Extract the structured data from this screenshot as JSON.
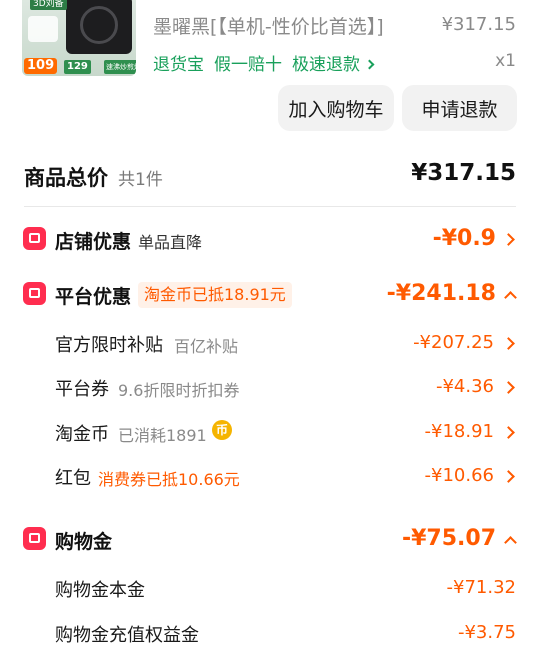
{
  "product": {
    "thumb": {
      "tag": "3D刘备",
      "price_main": "109",
      "price_secondary": "129",
      "strip": "速沸炒煎焖炖"
    },
    "sku": "墨曜黑[【单机-性价比首选】]",
    "unit_price": "¥317.15",
    "services": [
      "退货宝",
      "假一赔十",
      "极速退款"
    ],
    "quantity": "x1"
  },
  "actions": {
    "add_cart": "加入购物车",
    "refund": "申请退款"
  },
  "summary": {
    "title": "商品总价",
    "count": "共1件",
    "total": "¥317.15"
  },
  "store_discount": {
    "title": "店铺优惠",
    "sub": "单品直降",
    "value": "-¥0.9"
  },
  "platform_discount": {
    "title": "平台优惠",
    "badge": "淘金币已抵18.91元",
    "value": "-¥241.18",
    "items": [
      {
        "label": "官方限时补贴",
        "sub": "百亿补贴",
        "value": "-¥207.25"
      },
      {
        "label": "平台券",
        "sub": "9.6折限时折扣券",
        "value": "-¥4.36"
      },
      {
        "label": "淘金币",
        "sub": "已消耗1891",
        "value": "-¥18.91"
      },
      {
        "label": "红包",
        "sub": "消费券已抵10.66元",
        "value": "-¥10.66"
      }
    ]
  },
  "shopping_gold": {
    "title": "购物金",
    "value": "-¥75.07",
    "items": [
      {
        "label": "购物金本金",
        "value": "-¥71.32"
      },
      {
        "label": "购物金充值权益金",
        "value": "-¥3.75"
      }
    ]
  },
  "colors": {
    "accent": "#ff5a00",
    "brand_red": "#ff2d4f",
    "service_green": "#19a05b",
    "coin_gold": "#f5b400"
  },
  "icons": {
    "store": "store-icon",
    "platform": "platform-gift-icon",
    "gold": "shopping-bag-icon",
    "coin": "coin-icon"
  }
}
